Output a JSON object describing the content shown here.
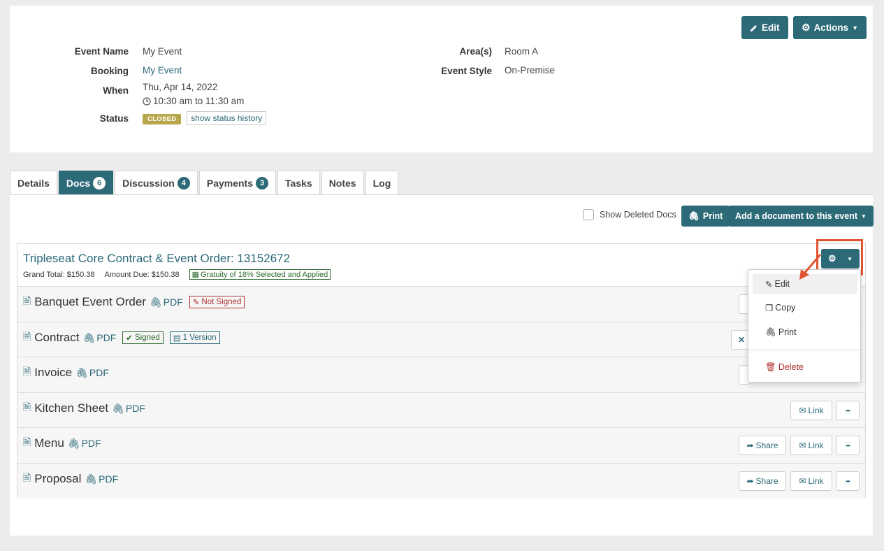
{
  "header": {
    "edit_label": "Edit",
    "actions_label": "Actions",
    "fields_left": [
      {
        "label": "Event Name",
        "value": "My Event"
      },
      {
        "label": "Booking",
        "value": "My Event"
      },
      {
        "label": "When",
        "value": "Thu, Apr 14, 2022"
      },
      {
        "label": "Status",
        "value": ""
      }
    ],
    "time": "10:30 am to 11:30 am",
    "status_badge": "CLOSED",
    "status_history": "show status history",
    "fields_right": [
      {
        "label": "Area(s)",
        "value": "Room A"
      },
      {
        "label": "Event Style",
        "value": "On-Premise"
      }
    ]
  },
  "tabs": [
    {
      "label": "Details",
      "count": ""
    },
    {
      "label": "Docs",
      "count": "6"
    },
    {
      "label": "Discussion",
      "count": "4"
    },
    {
      "label": "Payments",
      "count": "3"
    },
    {
      "label": "Tasks",
      "count": ""
    },
    {
      "label": "Notes",
      "count": ""
    },
    {
      "label": "Log",
      "count": ""
    }
  ],
  "toolbar": {
    "show_deleted": "Show Deleted Docs",
    "print": "Print",
    "add_doc": "Add a document to this event"
  },
  "contract": {
    "title": "Tripleseat Core Contract & Event Order: 13152672",
    "grand_total": "Grand Total: $150.38",
    "amount_due": "Amount Due: $150.38",
    "gratuity": "Gratuity of 18% Selected and Applied"
  },
  "docs": [
    {
      "name": "Banquet Event Order",
      "pdf": "PDF",
      "tag1": "Not Signed",
      "tag2": ""
    },
    {
      "name": "Contract",
      "pdf": "PDF",
      "tag1": "Signed",
      "tag2": "1 Version"
    },
    {
      "name": "Invoice",
      "pdf": "PDF",
      "tag1": "",
      "tag2": ""
    },
    {
      "name": "Kitchen Sheet",
      "pdf": "PDF",
      "tag1": "",
      "tag2": ""
    },
    {
      "name": "Menu",
      "pdf": "PDF",
      "tag1": "",
      "tag2": ""
    },
    {
      "name": "Proposal",
      "pdf": "PDF",
      "tag1": "",
      "tag2": ""
    }
  ],
  "row_buttons": {
    "share": "Share",
    "link": "Link",
    "more": "•••"
  },
  "dropdown": {
    "edit": "Edit",
    "copy": "Copy",
    "print": "Print",
    "delete": "Delete"
  },
  "colors": {
    "teal": "#2d6a78",
    "highlight": "#e05530",
    "closed": "#b8a74a"
  }
}
